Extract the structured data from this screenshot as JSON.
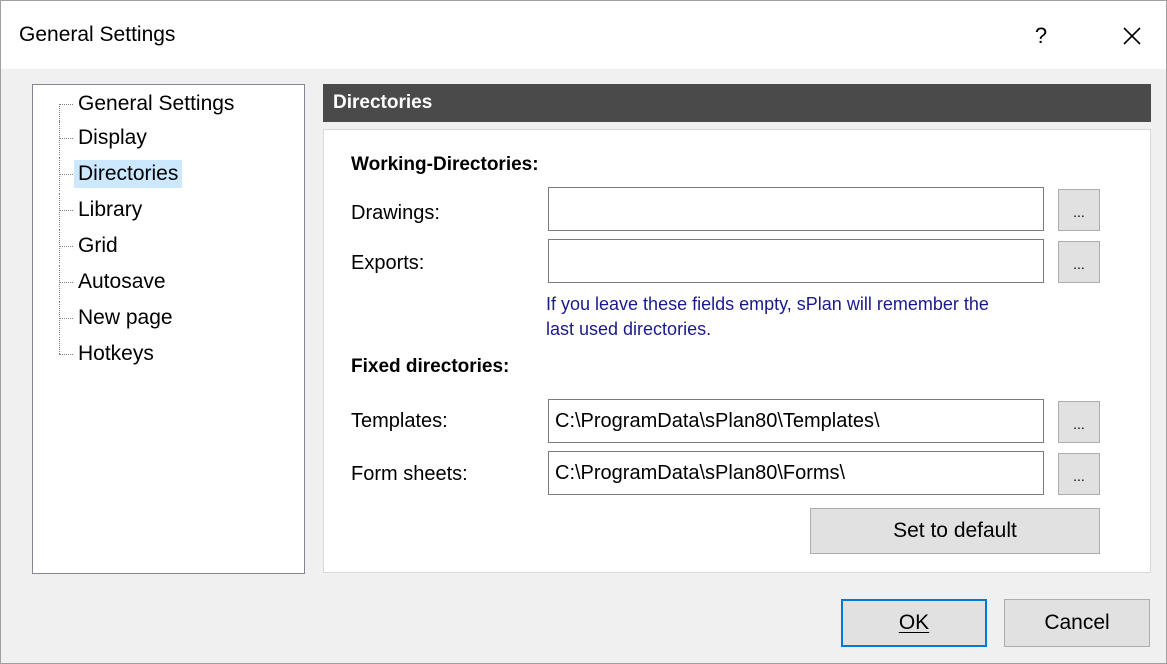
{
  "window": {
    "title": "General Settings",
    "help_label": "?",
    "close_icon": "close-icon"
  },
  "tree": {
    "items": [
      {
        "label": "General Settings",
        "selected": false
      },
      {
        "label": "Display",
        "selected": false
      },
      {
        "label": "Directories",
        "selected": true
      },
      {
        "label": "Library",
        "selected": false
      },
      {
        "label": "Grid",
        "selected": false
      },
      {
        "label": "Autosave",
        "selected": false
      },
      {
        "label": "New page",
        "selected": false
      },
      {
        "label": "Hotkeys",
        "selected": false
      }
    ]
  },
  "section": {
    "header": "Directories"
  },
  "working": {
    "group_label": "Working-Directories:",
    "drawings_label": "Drawings:",
    "drawings_value": "",
    "exports_label": "Exports:",
    "exports_value": "",
    "browse_label": "...",
    "hint_line1": "If you leave these fields empty, sPlan will remember the",
    "hint_line2": "last used directories."
  },
  "fixed": {
    "group_label": "Fixed directories:",
    "templates_label": "Templates:",
    "templates_value": "C:\\ProgramData\\sPlan80\\Templates\\",
    "forms_label": "Form sheets:",
    "forms_value": "C:\\ProgramData\\sPlan80\\Forms\\",
    "browse_label": "...",
    "default_label": "Set to default"
  },
  "footer": {
    "ok_label": "OK",
    "cancel_label": "Cancel"
  },
  "colors": {
    "header_bg": "#4a4a4a",
    "selection": "#cce8ff",
    "hint_text": "#1a1a8c",
    "focus_border": "#0078d7"
  }
}
